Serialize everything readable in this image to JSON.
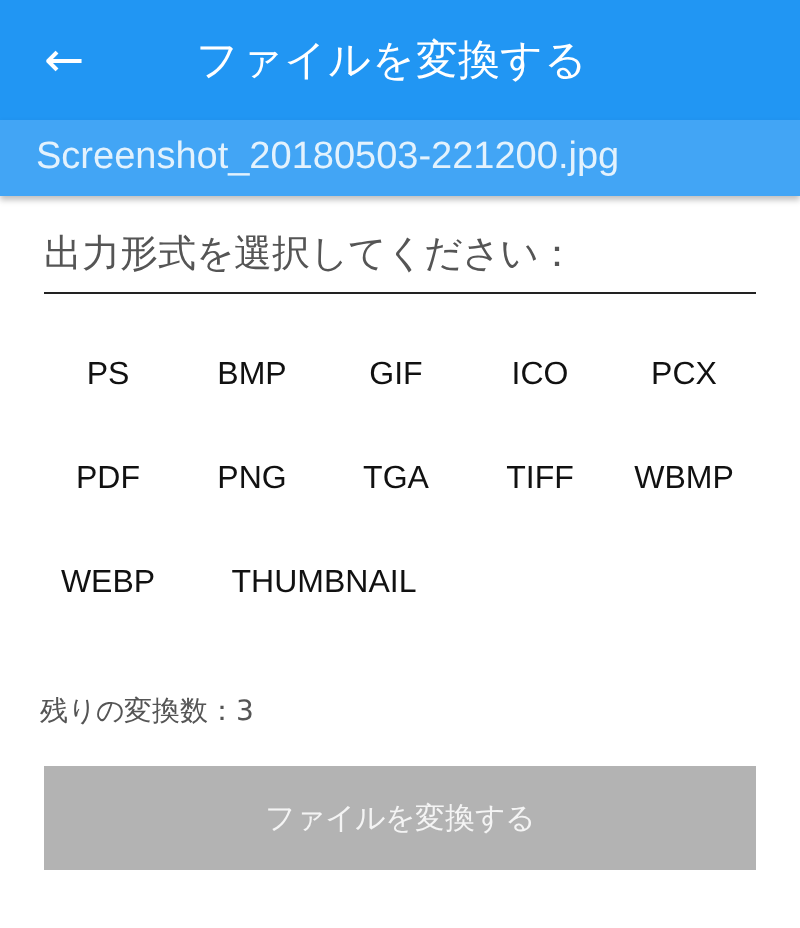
{
  "app_bar": {
    "back_icon": "←",
    "title": "ファイルを変換する"
  },
  "file_name": "Screenshot_20180503-221200.jpg",
  "format_prompt": "出力形式を選択してください：",
  "formats": [
    "PS",
    "BMP",
    "GIF",
    "ICO",
    "PCX",
    "PDF",
    "PNG",
    "TGA",
    "TIFF",
    "WBMP",
    "WEBP",
    "THUMBNAIL"
  ],
  "remaining": "残りの変換数：3",
  "convert_button": {
    "label": "ファイルを変換する",
    "disabled": true
  }
}
